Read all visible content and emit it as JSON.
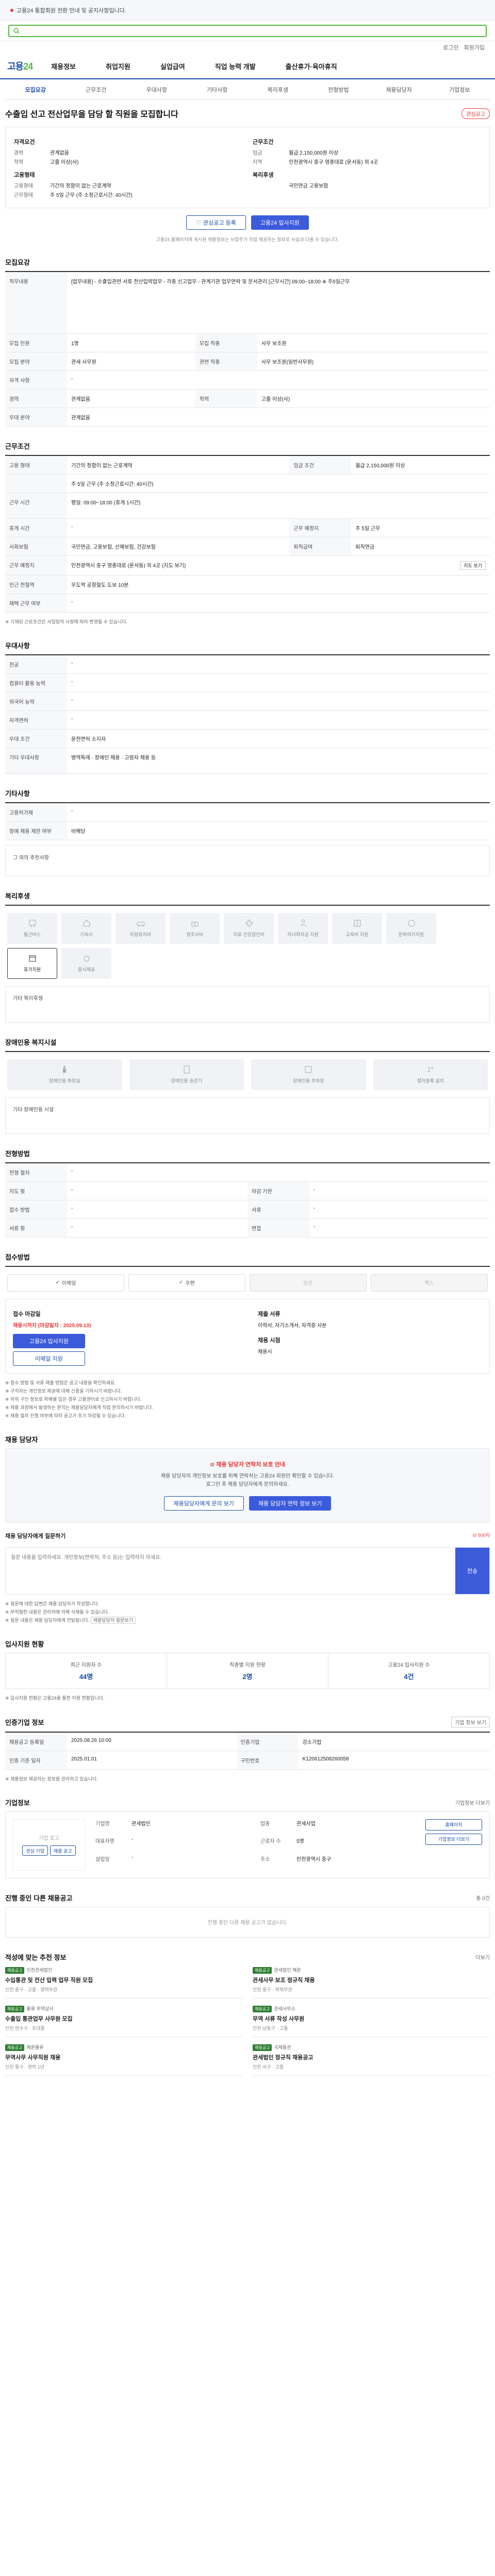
{
  "banner": {
    "text": "고용24 통합회원 전환 안내 및 공지사항입니다."
  },
  "header": {
    "logo_main": "고용",
    "logo_num": "24",
    "login": "로그인",
    "join": "회원가입",
    "gnb": [
      "채용정보",
      "취업지원",
      "실업급여",
      "직업 능력 개발",
      "출산휴가·육아휴직"
    ]
  },
  "subtabs": [
    "모집요강",
    "근무조건",
    "우대사항",
    "기타사항",
    "복리후생",
    "전형방법",
    "채용담당자",
    "기업정보"
  ],
  "job": {
    "title": "수출입 선고 전산업무을 담당 할 직원을 모집합니다",
    "scrap": "관심공고",
    "summary": {
      "left_h": "자격요건",
      "left": [
        {
          "k": "경력",
          "v": "관계없음"
        },
        {
          "k": "학력",
          "v": "고졸 이상(사)"
        }
      ],
      "left2_h": "고용형태",
      "left2": [
        {
          "k": "고용형태",
          "v": "기간의 정함이 없는 근로계약"
        },
        {
          "k": "근무형태",
          "v": "주 5일 근무 (주 소정근로시간: 40시간)"
        }
      ],
      "right_h": "근무조건",
      "right": [
        {
          "k": "임금",
          "v": "월급 2,150,000원 이상"
        },
        {
          "k": "지역",
          "v": "인천광역시 중구 영종대로 (운서동) 외 4곳"
        }
      ],
      "right2_h": "복리후생",
      "right2": [
        {
          "k": "",
          "v": "국민연금 고용보험"
        }
      ]
    },
    "btn_interest": "관심공고 등록",
    "btn_apply": "고용24 입사지원",
    "notice": "고용24 홈페이지에 게시된 채용정보는 사업주가 직접 제공하는 정보로 사실과 다를 수 있습니다."
  },
  "recruit": {
    "title": "모집요강",
    "job_desc_h": "직무내용",
    "job_desc": "[업무내용] - 수출입관련 서류 전산입력업무 - 각종 신고업무 - 관계기관 업무연락 및 문서관리 [근무시간] 09:00~18:00 ※ 주5일근무",
    "rows": [
      {
        "k": "모집 인원",
        "v": "1명",
        "k2": "모집 직종",
        "v2": "사무 보조원"
      },
      {
        "k": "모집 분야",
        "v": "관세 사무원",
        "k2": "관련 직종",
        "v2": "사무 보조원(일반사무원)"
      },
      {
        "k": "자격 사항",
        "v": "-",
        "k2": "",
        "v2": ""
      },
      {
        "k": "경력",
        "v": "관계없음",
        "k2": "학력",
        "v2": "고졸 이상(사)"
      },
      {
        "k": "우대 분야",
        "v": "관계없음",
        "k2": "",
        "v2": ""
      }
    ]
  },
  "work": {
    "title": "근무조건",
    "rows": [
      {
        "k": "고용 형태",
        "v": "기간의 정함이 없는 근로계약",
        "k2": "임금 조건",
        "v2": "월급 2,150,000원 이상"
      },
      {
        "k": "",
        "v": "주 5일 근무 (주 소정근로시간: 40시간)",
        "k2": "",
        "v2": ""
      },
      {
        "k": "근무 시간",
        "v": "평일: 09:00~18:00 (휴게 1시간)",
        "k2": "",
        "v2": ""
      },
      {
        "k": "휴게 시간",
        "v": "-",
        "k2": "근무 예정지",
        "v2": "주 5일 근무"
      },
      {
        "k": "사회보험",
        "v": "국민연금, 고용보험, 산재보험, 건강보험",
        "k2": "퇴직급여",
        "v2": "퇴직연금"
      },
      {
        "k": "근무 예정지",
        "v": "인천광역시 중구 영종대로 (운서동) 외 4곳 (지도 보기)",
        "k2": "",
        "v2": ""
      },
      {
        "k": "인근 전철역",
        "v": "우도역 공항철도 도보 10분",
        "k2": "",
        "v2": ""
      },
      {
        "k": "재택 근무 여부",
        "v": "-",
        "k2": "",
        "v2": ""
      }
    ],
    "map_btn": "지도 보기",
    "note": "※ 기재된 근로조건은 사업장의 사정에 따라 변경될 수 있습니다."
  },
  "pref": {
    "title": "우대사항",
    "rows": [
      {
        "k": "전공",
        "v": "-"
      },
      {
        "k": "컴퓨터 활용 능력",
        "v": "-"
      },
      {
        "k": "외국어 능력",
        "v": "-"
      },
      {
        "k": "자격면허",
        "v": "-"
      },
      {
        "k": "우대 조건",
        "v": "운전면허 소지자"
      },
      {
        "k": "기타 우대사항",
        "v": "병역특례 · 장애인 채용 · 고령자 채용 등"
      }
    ]
  },
  "etc": {
    "title": "기타사항",
    "rows": [
      {
        "k": "고용허가제",
        "v": "-"
      },
      {
        "k": "장애 채용 제한 여부",
        "v": "비해당"
      }
    ],
    "extra": "그 외의 추천사항"
  },
  "welfare": {
    "title": "복리후생",
    "items": [
      "통근버스",
      "기숙사",
      "차량유지비",
      "경조사비",
      "의료 건강검진비",
      "자녀학자금 지원",
      "교육비 지원",
      "문화여가지원",
      "휴가지원",
      "중식제공"
    ],
    "extra": "기타 복리후생"
  },
  "facility": {
    "title": "장애인용 복지시설",
    "items": [
      "장애인용 화장실",
      "장애인용 승강기",
      "장애인용 주차장",
      "점자블록 설치"
    ],
    "extra": "기타 장애인용 시설"
  },
  "screen": {
    "title": "전형방법",
    "rows": [
      {
        "k": "전형 절차",
        "v": "-",
        "k2": "",
        "v2": ""
      },
      {
        "k": "지도 횟",
        "v": "-",
        "k2": "마감 기한",
        "v2": "-"
      },
      {
        "k": "접수 방법",
        "v": "-",
        "k2": "서류",
        "v2": "-"
      },
      {
        "k": "서류 횟",
        "v": "-",
        "k2": "면접",
        "v2": "-"
      }
    ]
  },
  "method": {
    "title": "접수방법",
    "items": [
      {
        "label": "이메일",
        "on": true
      },
      {
        "label": "우편",
        "on": true
      },
      {
        "label": "방문",
        "on": false
      },
      {
        "label": "팩스",
        "on": false
      }
    ],
    "deadline_h": "접수 마감일",
    "deadline": "채용시까지 (마감일자 : 2025.09.13)",
    "docs_h": "제출 서류",
    "docs": "이력서, 자기소개서, 자격증 사본",
    "apply_btn": "고용24 입사지원",
    "email_btn": "이메일 지원",
    "result_h": "채용 시점",
    "result": "채용시",
    "notes": [
      "※ 접수 방법 및 서류 제출 방법은 공고 내용을 확인하세요.",
      "※ 구직자는 개인정보 제공에 대해 신중을 기하시기 바랍니다.",
      "※ 허위 구인 정보로 피해를 입은 경우 고용센터로 신고하시기 바랍니다.",
      "※ 채용 과정에서 발생하는 문의는 채용담당자에게 직접 문의하시기 바랍니다.",
      "※ 채용 절차 진행 여부에 따라 공고가 조기 마감될 수 있습니다."
    ]
  },
  "contact": {
    "title": "채용 담당자",
    "warn": "채용 담당자 연락처 보호 안내",
    "desc1": "채용 담당자의 개인정보 보호를 위해 연락처는 고용24 회원만 확인할 수 있습니다.",
    "desc2": "로그인 후 채용 담당자에게 문의하세요.",
    "btn_q": "채용담당자에게 문의 보기",
    "btn_login": "채용 담당자 연락 정보 보기",
    "q_label": "채용 담당자에게 질문하기",
    "q_sub": "0/ 500자",
    "q_placeholder": "질문 내용을 입력하세요. 개인정보(연락처, 주소 등)는 입력하지 마세요.",
    "q_send": "전송",
    "q_notes": [
      "※ 질문에 대한 답변은 채용 담당자가 작성합니다.",
      "※ 부적절한 내용은 관리자에 의해 삭제될 수 있습니다.",
      "※ 질문 내용은 채용 담당자에게 전달됩니다."
    ],
    "q_link": "채용담당자 질문보기"
  },
  "stats": {
    "title": "입사지원 현황",
    "items": [
      {
        "label": "최근 지원자 수",
        "v": "44명"
      },
      {
        "label": "직종별 지원 현황",
        "v": "2명"
      },
      {
        "label": "고용24 입사지원 수",
        "v": "4건"
      }
    ],
    "note": "※ 입사지원 현황은 고용24를 통한 지원 현황입니다."
  },
  "info": {
    "title": "인증기업 정보",
    "link": "기업 정보 보기",
    "rows": [
      {
        "k": "채용공고 등록일",
        "v": "2025.08.26 10:00",
        "k2": "인증기업",
        "v2": "강소기업"
      },
      {
        "k": "인증 기준 일자",
        "v": "2025.01.01",
        "k2": "구인번호",
        "v2": "K120612508260058"
      }
    ],
    "note": "※ 채용정보 제공자는 정보를 관리하고 있습니다."
  },
  "company": {
    "title": "기업정보",
    "more": "기업정보 더보기",
    "logo_text": "기업 로고",
    "btn_left": "관심 기업",
    "btn_right": "채용 공고",
    "info": [
      {
        "k": "기업명",
        "v": "관세법인"
      },
      {
        "k": "업종",
        "v": "관세사업"
      },
      {
        "k": "대표자명",
        "v": "-"
      },
      {
        "k": "근로자 수",
        "v": "5명"
      },
      {
        "k": "설립일",
        "v": "-"
      },
      {
        "k": "주소",
        "v": "인천광역시 중구"
      }
    ],
    "side_btns": [
      "홈페이지",
      "기업정보 더보기"
    ]
  },
  "ongoing": {
    "title": "진행 중인 다른 채용공고",
    "sub": "총 0건",
    "empty": "진행 중인 다른 채용 공고가 없습니다."
  },
  "recommend": {
    "title": "적성에 맞는 추천 정보",
    "more": "더보기",
    "cards": [
      {
        "badge": "채용공고",
        "co": "인천관세법인",
        "t": "수입통관 및 전산 입력 업무 직원 모집",
        "m": "인천 중구 · 고졸 · 경력무관"
      },
      {
        "badge": "채용공고",
        "co": "관세법인 해운",
        "t": "관세사무 보조 정규직 채용",
        "m": "인천 중구 · 학력무관"
      },
      {
        "badge": "채용공고",
        "co": "물류 무역상사",
        "t": "수출입 통관업무 사무원 모집",
        "m": "인천 연수구 · 초대졸"
      },
      {
        "badge": "채용공고",
        "co": "관세사무소",
        "t": "무역 서류 작성 사무원",
        "m": "인천 남동구 · 고졸"
      },
      {
        "badge": "채용공고",
        "co": "해운물류",
        "t": "무역사무 사무직원 채용",
        "m": "인천 중구 · 경력 1년"
      },
      {
        "badge": "채용공고",
        "co": "국제통관",
        "t": "관세법인 정규직 채용공고",
        "m": "인천 서구 · 고졸"
      }
    ]
  }
}
